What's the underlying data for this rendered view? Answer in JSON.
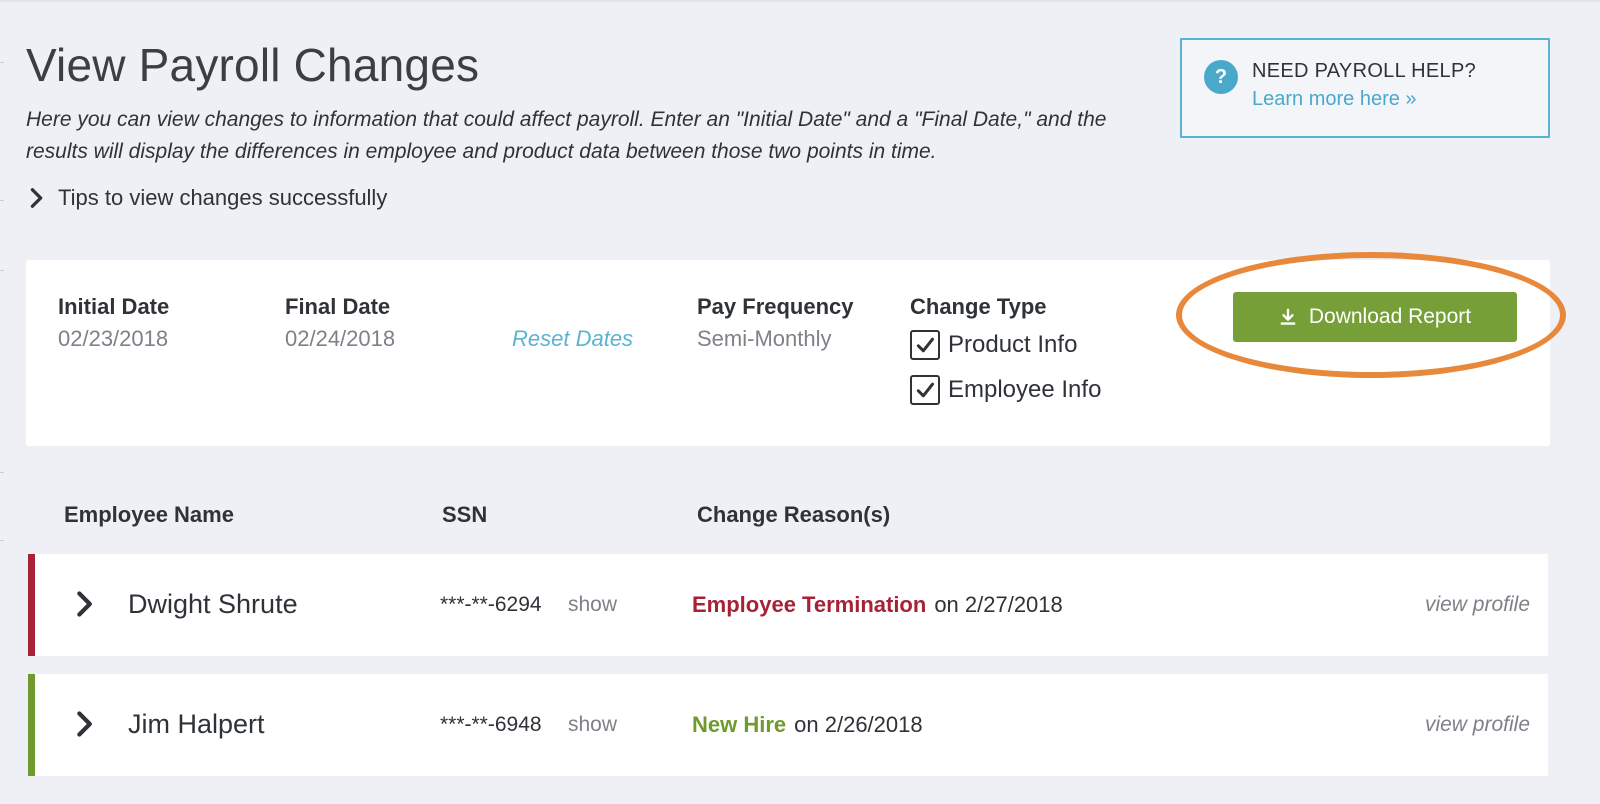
{
  "page": {
    "title": "View Payroll Changes",
    "description": "Here you can view changes to information that could affect payroll. Enter an \"Initial Date\" and a \"Final Date,\" and the results will display the differences in employee and product data between those two points in time.",
    "tips_label": "Tips to view changes successfully"
  },
  "help": {
    "title": "NEED PAYROLL HELP?",
    "link": "Learn more here »",
    "icon_glyph": "?"
  },
  "filters": {
    "initial_date_label": "Initial Date",
    "initial_date_value": "02/23/2018",
    "final_date_label": "Final Date",
    "final_date_value": "02/24/2018",
    "reset_label": "Reset Dates",
    "pay_frequency_label": "Pay Frequency",
    "pay_frequency_value": "Semi-Monthly",
    "change_type_label": "Change Type",
    "change_types": [
      {
        "label": "Product Info",
        "checked": true
      },
      {
        "label": "Employee Info",
        "checked": true
      }
    ],
    "download_label": "Download Report"
  },
  "table": {
    "headers": [
      "Employee Name",
      "SSN",
      "Change Reason(s)"
    ],
    "rows": [
      {
        "name": "Dwight Shrute",
        "ssn": "***-**-6294",
        "show_label": "show",
        "reason": "Employee Termination",
        "reason_date": "on 2/27/2018",
        "reason_color": "#a62236",
        "view_profile_label": "view profile"
      },
      {
        "name": "Jim Halpert",
        "ssn": "***-**-6948",
        "show_label": "show",
        "reason": "New Hire",
        "reason_date": "on 2/26/2018",
        "reason_color": "#6e9a2e",
        "view_profile_label": "view profile"
      }
    ]
  },
  "colors": {
    "accent_blue": "#4aa9cb",
    "download_green": "#76a037",
    "termination_red": "#a62236",
    "new_hire_green": "#6e9a2e",
    "highlight_orange": "#e8883a"
  }
}
